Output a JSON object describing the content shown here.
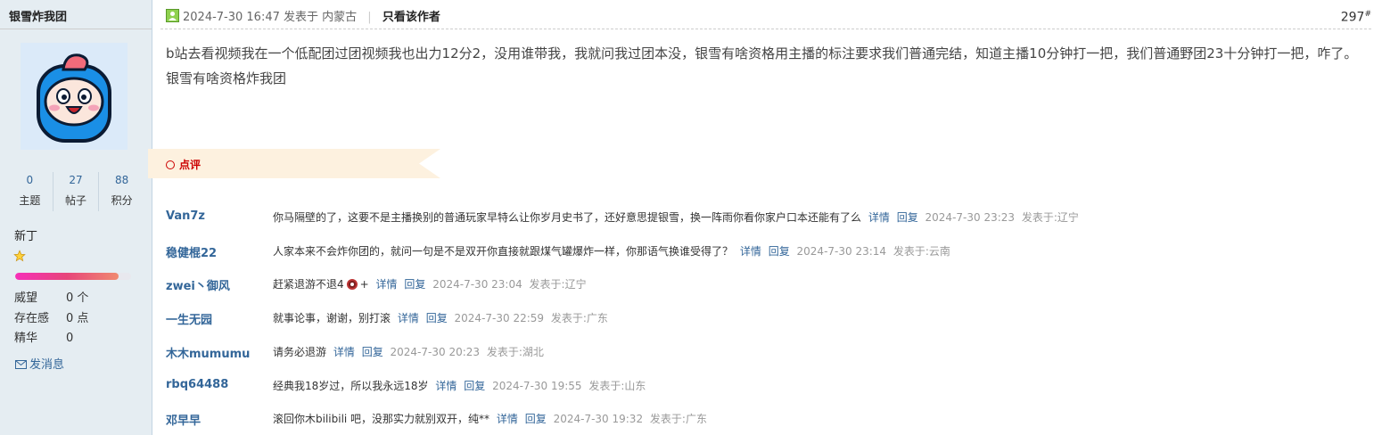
{
  "sidebar": {
    "username": "银雪炸我团",
    "stats": [
      {
        "value": "0",
        "label": "主题"
      },
      {
        "value": "27",
        "label": "帖子"
      },
      {
        "value": "88",
        "label": "积分"
      }
    ],
    "rank": "新丁",
    "progress": 0.89,
    "info": [
      {
        "key": "威望",
        "value": "0 个"
      },
      {
        "key": "存在感",
        "value": "0 点"
      },
      {
        "key": "精华",
        "value": "0"
      }
    ],
    "send_message": "发消息"
  },
  "post": {
    "posted_at": "2024-7-30 16:47",
    "location": "发表于 内蒙古",
    "author_only": "只看该作者",
    "floor": "297",
    "floor_mark": "#",
    "body": "b站去看视频我在一个低配团过团视频我也出力12分2，没用谁带我，我就问我过团本没，银雪有啥资格用主播的标注要求我们普通完结，知道主播10分钟打一把，我们普通野团23十分钟打一把，咋了。银雪有啥资格炸我团"
  },
  "ribbon": {
    "label": "点评"
  },
  "comments": [
    {
      "user": "Van7z",
      "text": "你马隔壁的了，这要不是主播换别的普通玩家早特么让你岁月史书了，还好意思提银雪，换一阵雨你看你家户口本还能有了么",
      "detail": "详情",
      "reply": "回复",
      "time": "2024-7-30 23:23",
      "loc": "发表于:辽宁"
    },
    {
      "user": "稳健棍22",
      "text": "人家本来不会炸你团的，就问一句是不是双开你直接就跟煤气罐爆炸一样，你那语气换谁受得了？",
      "detail": "详情",
      "reply": "回复",
      "time": "2024-7-30 23:14",
      "loc": "发表于:云南"
    },
    {
      "user": "zwei丶御风",
      "text": "赶紧退游不退4",
      "text_after": "+",
      "detail": "详情",
      "reply": "回复",
      "time": "2024-7-30 23:04",
      "loc": "发表于:辽宁"
    },
    {
      "user": "一生无园",
      "text": "就事论事，谢谢，别打滚",
      "detail": "详情",
      "reply": "回复",
      "time": "2024-7-30 22:59",
      "loc": "发表于:广东"
    },
    {
      "user": "木木mumumu",
      "text": "请务必退游",
      "detail": "详情",
      "reply": "回复",
      "time": "2024-7-30 20:23",
      "loc": "发表于:湖北"
    },
    {
      "user": "rbq64488",
      "text": "经典我18岁过，所以我永远18岁",
      "detail": "详情",
      "reply": "回复",
      "time": "2024-7-30 19:55",
      "loc": "发表于:山东"
    },
    {
      "user": "邓早早",
      "text": "滚回你木bilibili 吧，没那实力就别双开，纯**",
      "detail": "详情",
      "reply": "回复",
      "time": "2024-7-30 19:32",
      "loc": "发表于:广东"
    }
  ],
  "colors": {
    "link": "#336699",
    "sidebar_bg": "#e5edf2",
    "ribbon": "#fdf1df",
    "accent_red": "#cc0000"
  },
  "icons": [
    "avatar-cartoon",
    "online-user-icon",
    "star-icon",
    "envelope-icon",
    "circle-icon",
    "emoji-badge-icon"
  ]
}
